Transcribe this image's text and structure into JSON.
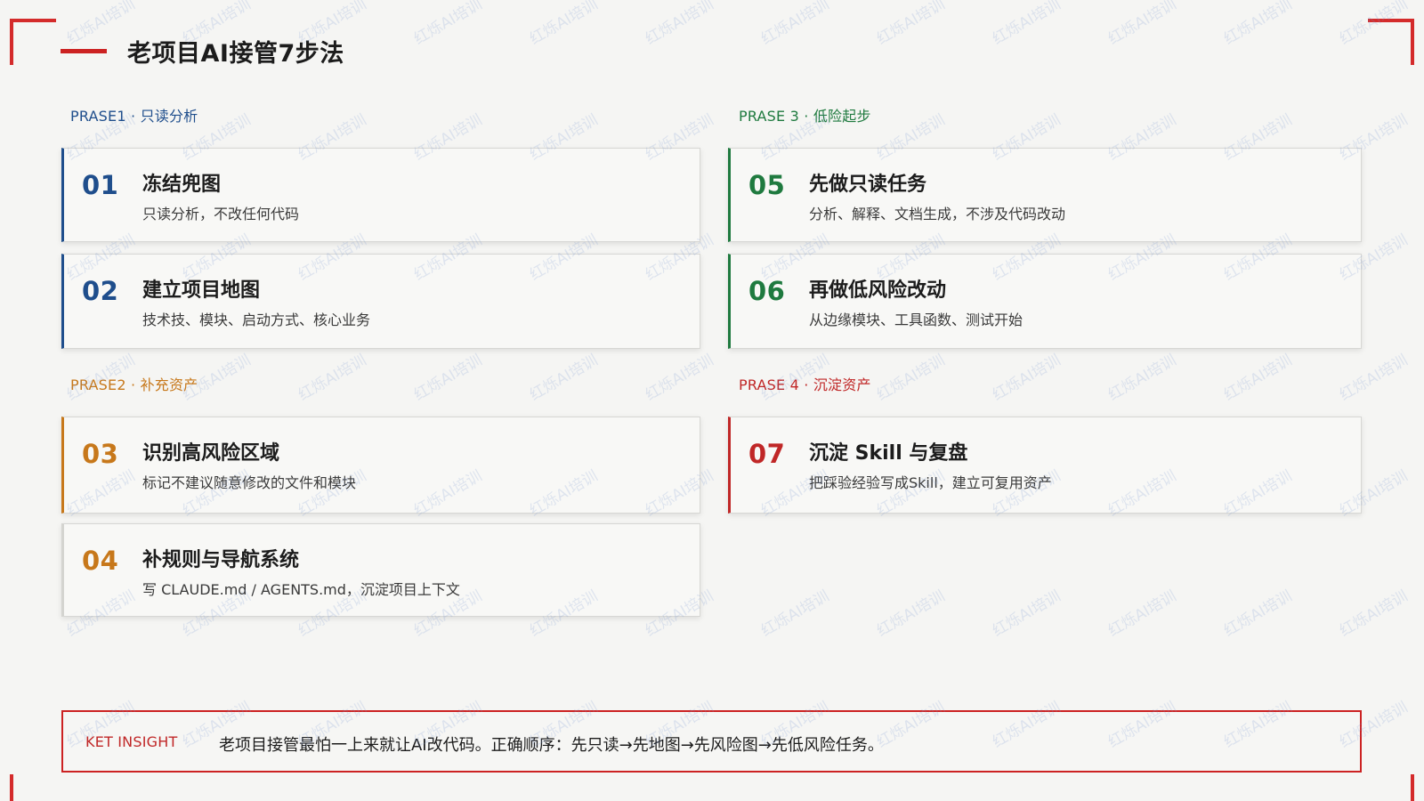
{
  "header": {
    "title": "老项目AI接管7步法"
  },
  "phases": [
    {
      "label": "PRASE1 · 只读分析",
      "color": "#1f4e8c"
    },
    {
      "label": "PRASE2 · 补充资产",
      "color": "#c7781b"
    },
    {
      "label": "PRASE 3 · 低险起步",
      "color": "#1f7a3f"
    },
    {
      "label": "PRASE 4 · 沉淀资产",
      "color": "#c02727"
    }
  ],
  "steps": [
    {
      "num": "01",
      "title": "冻结兜图",
      "desc": "只读分析，不改任何代码"
    },
    {
      "num": "02",
      "title": "建立项目地图",
      "desc": "技术技、模块、启动方式、核心业务"
    },
    {
      "num": "03",
      "title": "识别高风险区域",
      "desc": "标记不建议随意修改的文件和模块"
    },
    {
      "num": "04",
      "title": "补规则与导航系统",
      "desc": "写 CLAUDE.md / AGENTS.md，沉淀项目上下文"
    },
    {
      "num": "05",
      "title": "先做只读任务",
      "desc": "分析、解释、文档生成，不涉及代码改动"
    },
    {
      "num": "06",
      "title": "再做低风险改动",
      "desc": "从边缘模块、工具函数、测试开始"
    },
    {
      "num": "07",
      "title": "沉淀 Skill 与复盘",
      "desc": "把踩验经验写成Skill，建立可复用资产"
    }
  ],
  "insight": {
    "label": "KET INSIGHT",
    "text": "老项目接管最怕一上来就让AI改代码。正确顺序：先只读→先地图→先风险图→先低风险任务。"
  },
  "watermark": {
    "text": "红烁AI培训"
  },
  "colors": {
    "accent_red": "#cc2222",
    "phase1_blue": "#1f4e8c",
    "phase2_orange": "#c7781b",
    "phase3_green": "#1f7a3f",
    "phase4_red": "#c02727"
  }
}
